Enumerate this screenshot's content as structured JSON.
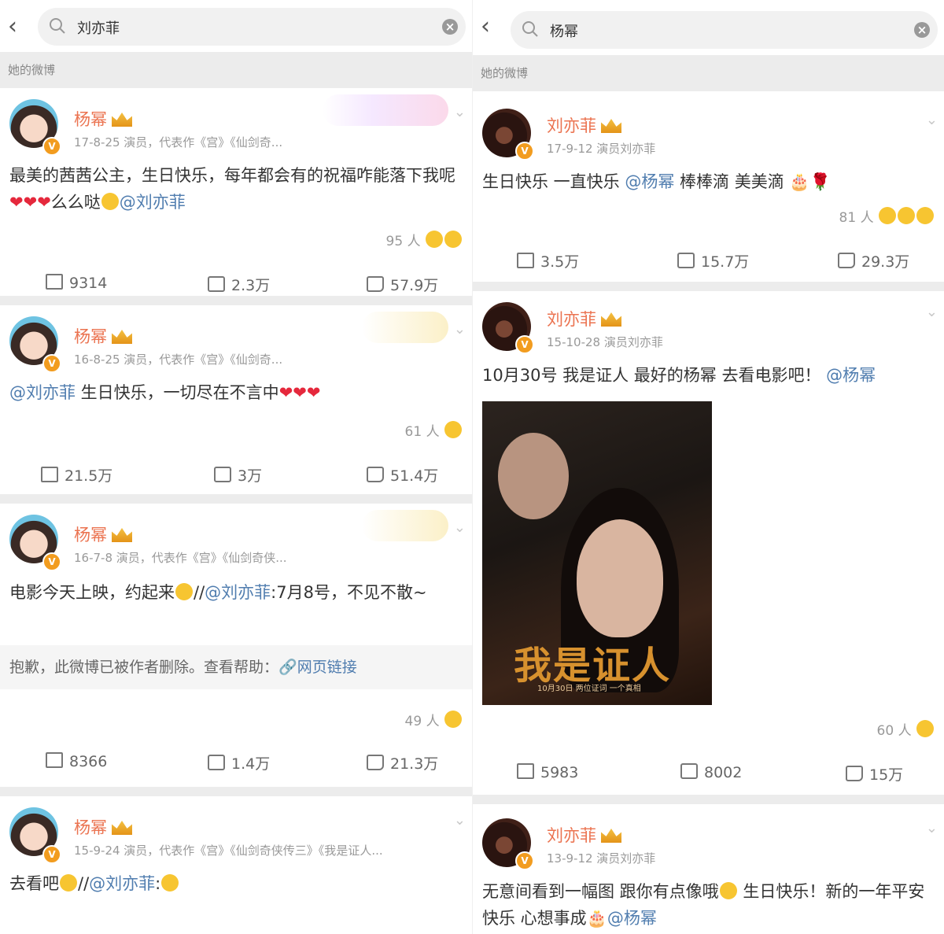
{
  "left": {
    "search_query": "刘亦菲",
    "section_label": "她的微博",
    "posts": [
      {
        "author": "杨幂",
        "meta": "17-8-25  演员，代表作《宫》《仙剑奇...",
        "text_a": "最美的茜茜公主，生日快乐，每年都会有的祝福咋能落下我呢",
        "text_b": "么么哒",
        "mention": "@刘亦菲",
        "likes_people": "95 人",
        "repost": "9314",
        "comment": "2.3万",
        "like": "57.9万"
      },
      {
        "author": "杨幂",
        "meta": "16-8-25  演员，代表作《宫》《仙剑奇...",
        "mention": "@刘亦菲",
        "text_a": " 生日快乐，一切尽在不言中",
        "likes_people": "61 人",
        "repost": "21.5万",
        "comment": "3万",
        "like": "51.4万"
      },
      {
        "author": "杨幂",
        "meta": "16-7-8  演员，代表作《宫》《仙剑奇侠...",
        "text_a": "电影今天上映，约起来",
        "text_b": "//",
        "mention": "@刘亦菲",
        "text_c": ":7月8号，不见不散~",
        "deleted_text": "抱歉，此微博已被作者删除。查看帮助：",
        "deleted_link": "网页链接",
        "likes_people": "49 人",
        "repost": "8366",
        "comment": "1.4万",
        "like": "21.3万"
      },
      {
        "author": "杨幂",
        "meta": "15-9-24  演员，代表作《宫》《仙剑奇侠传三》《我是证人...",
        "text_a": "去看吧",
        "text_b": "//",
        "mention": "@刘亦菲",
        "text_c": ":"
      }
    ]
  },
  "right": {
    "search_query": "杨幂",
    "section_label": "她的微博",
    "posts": [
      {
        "author": "刘亦菲",
        "meta": "17-9-12  演员刘亦菲",
        "text_a": "生日快乐 一直快乐 ",
        "mention": "@杨幂",
        "text_b": " 棒棒滴 美美滴",
        "likes_people": "81 人",
        "repost": "3.5万",
        "comment": "15.7万",
        "like": "29.3万"
      },
      {
        "author": "刘亦菲",
        "meta": "15-10-28  演员刘亦菲",
        "text_a": "10月30号 我是证人 最好的杨幂 去看电影吧！",
        "mention": "@杨幂",
        "poster_title": "我是证人",
        "poster_sub": "10月30日 两位证词 一个真相",
        "likes_people": "60 人",
        "repost": "5983",
        "comment": "8002",
        "like": "15万"
      },
      {
        "author": "刘亦菲",
        "meta": "13-9-12  演员刘亦菲",
        "text_a": "无意间看到一幅图 跟你有点像哦",
        "text_b": " 生日快乐！新的一年平安 快乐 心想事成",
        "mention": "@杨幂"
      }
    ]
  }
}
